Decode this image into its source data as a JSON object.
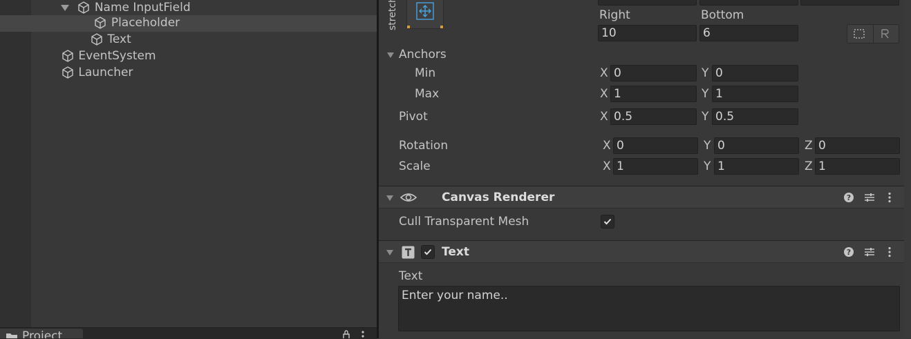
{
  "hierarchy": {
    "items": [
      {
        "label": "Name InputField",
        "expanded": true
      },
      {
        "label": "Placeholder",
        "selected": true
      },
      {
        "label": "Text"
      },
      {
        "label": "EventSystem"
      },
      {
        "label": "Launcher"
      }
    ],
    "project_tab_label": "Project"
  },
  "rect_transform": {
    "anchor_preset_label": "stretch",
    "right_label": "Right",
    "bottom_label": "Bottom",
    "right_value": "10",
    "bottom_value": "6",
    "anchors_label": "Anchors",
    "min_label": "Min",
    "max_label": "Max",
    "min_x": "0",
    "min_y": "0",
    "max_x": "1",
    "max_y": "1",
    "pivot_label": "Pivot",
    "pivot_x": "0.5",
    "pivot_y": "0.5",
    "rotation_label": "Rotation",
    "rotation_x": "0",
    "rotation_y": "0",
    "rotation_z": "0",
    "scale_label": "Scale",
    "scale_x": "1",
    "scale_y": "1",
    "scale_z": "1",
    "axis_x": "X",
    "axis_y": "Y",
    "axis_z": "Z"
  },
  "canvas_renderer": {
    "title": "Canvas Renderer",
    "cull_label": "Cull Transparent Mesh",
    "cull_checked": true
  },
  "text_component": {
    "title": "Text",
    "enabled": true,
    "text_label": "Text",
    "text_value": "Enter your name.."
  },
  "icons": [
    "cube-icon",
    "eye-icon",
    "help-icon",
    "presets-icon",
    "kebab-menu-icon",
    "text-t-icon",
    "checkmark-icon",
    "blueprint-mode-icon",
    "raw-edit-icon",
    "lock-icon"
  ],
  "colors": {
    "panel_bg": "#383838",
    "field_bg": "#2a2a2a",
    "selection_bg": "#464646",
    "anchor_blue": "#4aa3e0"
  }
}
